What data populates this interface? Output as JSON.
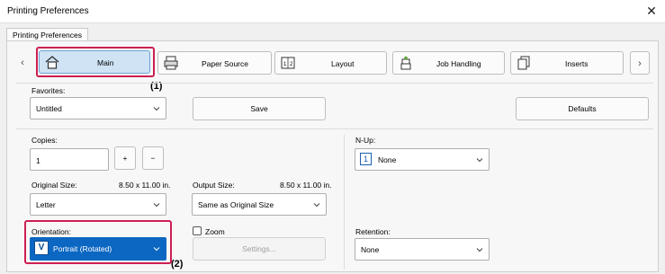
{
  "window": {
    "title": "Printing Preferences",
    "close_glyph": "✕"
  },
  "tabs": [
    {
      "label": "Printing Preferences"
    }
  ],
  "nav": {
    "prev_glyph": "‹",
    "next_glyph": "›",
    "items": [
      {
        "label": "Main",
        "icon": "home-icon",
        "selected": true
      },
      {
        "label": "Paper Source",
        "icon": "printer-icon"
      },
      {
        "label": "Layout",
        "icon": "layout-icon"
      },
      {
        "label": "Job Handling",
        "icon": "job-stack-icon"
      },
      {
        "label": "Inserts",
        "icon": "inserts-icon"
      }
    ]
  },
  "callouts": {
    "one": "(1)",
    "two": "(2)"
  },
  "favorites": {
    "label": "Favorites:",
    "value": "Untitled",
    "save_label": "Save",
    "defaults_label": "Defaults"
  },
  "copies": {
    "label": "Copies:",
    "value": "1",
    "plus": "+",
    "minus": "−"
  },
  "original_size": {
    "label": "Original Size:",
    "dimension": "8.50 x 11.00 in.",
    "value": "Letter"
  },
  "output_size": {
    "label": "Output Size:",
    "dimension": "8.50 x 11.00 in.",
    "value": "Same as Original Size"
  },
  "nup": {
    "label": "N-Up:",
    "icon_text": "1",
    "value": "None"
  },
  "orientation": {
    "label": "Orientation:",
    "icon_text": "V",
    "value": "Portrait (Rotated)"
  },
  "zoom": {
    "label": "Zoom",
    "checked": false,
    "settings_label": "Settings..."
  },
  "retention": {
    "label": "Retention:",
    "value": "None"
  },
  "colors": {
    "accent": "#0b67c2",
    "callout_border": "#cc1f52",
    "selected_tab_bg": "#cfe3f5"
  }
}
